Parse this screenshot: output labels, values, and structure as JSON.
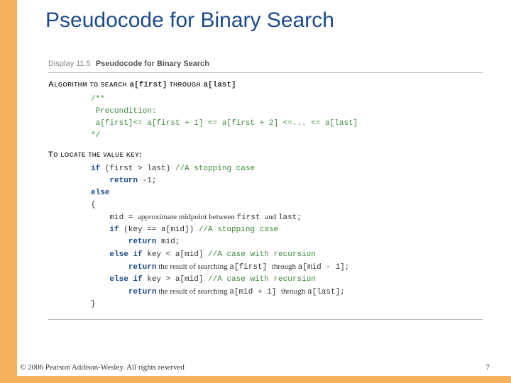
{
  "title": "Pseudocode for Binary Search",
  "display": {
    "label": "Display 11.5",
    "title": "Pseudocode for Binary Search"
  },
  "algorithm_heading": {
    "prefix": "Algorithm to search ",
    "mono1": "a[first]",
    "mid": " through ",
    "mono2": "a[last]"
  },
  "precond": {
    "l1": "/**",
    "l2": " Precondition:",
    "l3": " a[first]<= a[first + 1] <= a[first + 2] <=... <= a[last]",
    "l4": "*/"
  },
  "locate_heading": "To locate the value key:",
  "code": {
    "l1_kw": "if",
    "l1_code": " (first > last) ",
    "l1_cm": "//A stopping case",
    "l2_kw": "return",
    "l2_code": " -1;",
    "l3_kw": "else",
    "l4": "{",
    "l5_code": "mid = ",
    "l5_nar": "approximate midpoint between ",
    "l5_code2": "first ",
    "l5_nar2": "and ",
    "l5_code3": "last;",
    "l6_kw": "if",
    "l6_code": " (key == a[mid]) ",
    "l6_cm": "//A stopping case",
    "l7_kw": "return",
    "l7_code": " mid;",
    "l8_kw": "else if",
    "l8_code": " key < a[mid] ",
    "l8_cm": "//A case with recursion",
    "l9_kw": "return",
    "l9_nar": " the result of searching ",
    "l9_code": "a[first] ",
    "l9_nar2": "through ",
    "l9_code2": "a[mid - 1];",
    "l10_kw": "else if",
    "l10_code": " key > a[mid] ",
    "l10_cm": "//A case with recursion",
    "l11_kw": "return",
    "l11_nar": " the result of searching ",
    "l11_code": "a[mid + 1] ",
    "l11_nar2": "through ",
    "l11_code2": "a[last];",
    "l12": "}"
  },
  "footer": "© 2006 Pearson Addison-Wesley. All rights reserved",
  "page_number": "7"
}
